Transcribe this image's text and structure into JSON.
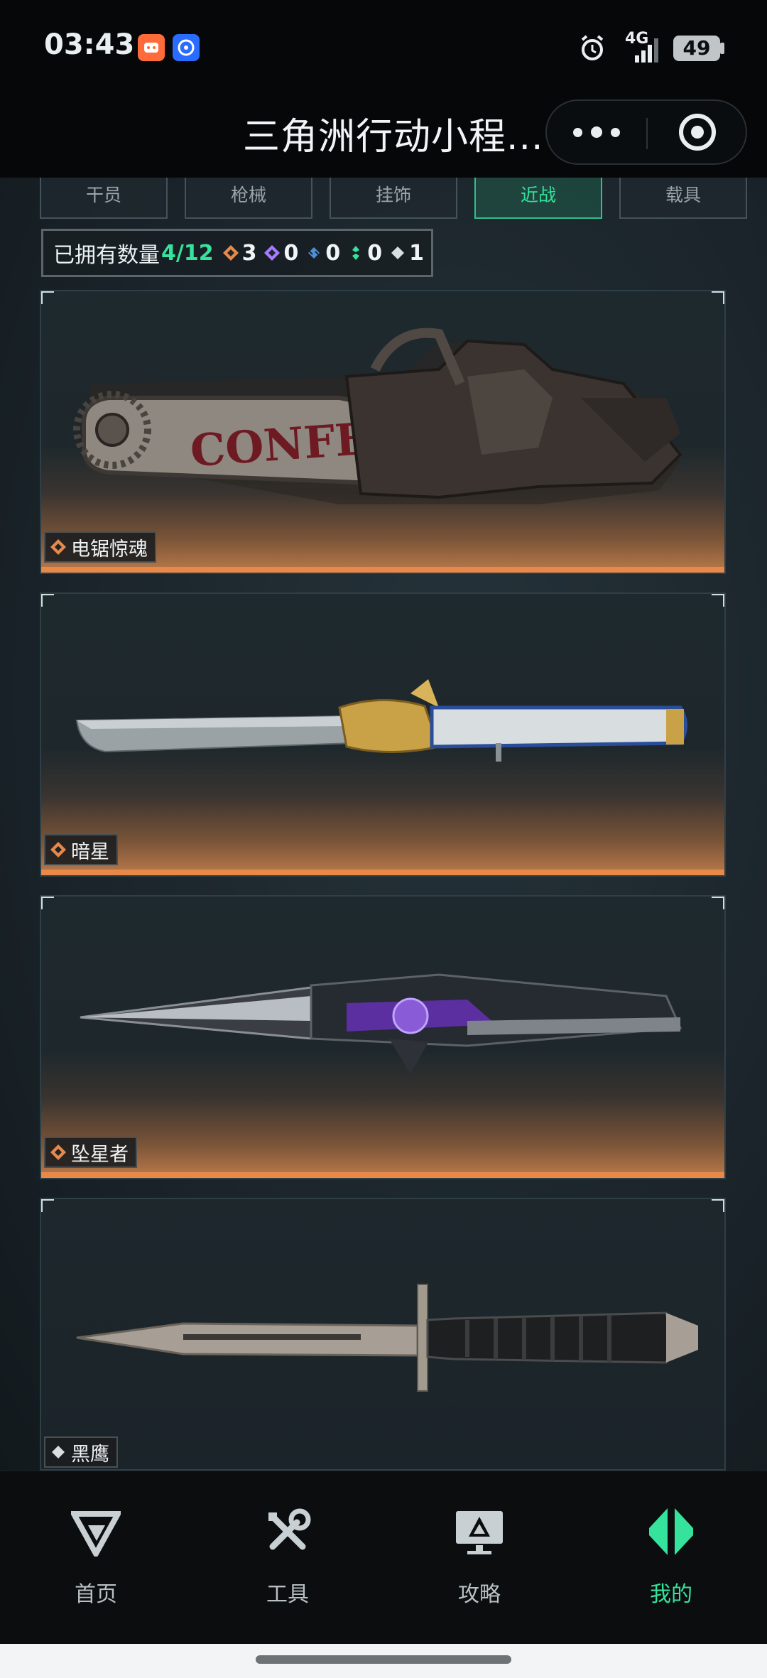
{
  "status_bar": {
    "time": "03:43",
    "network": "4G",
    "battery": "49"
  },
  "header": {
    "title": "三角洲行动小程..."
  },
  "tabs": [
    {
      "label": "干员",
      "active": false
    },
    {
      "label": "枪械",
      "active": false
    },
    {
      "label": "挂饰",
      "active": false
    },
    {
      "label": "近战",
      "active": true
    },
    {
      "label": "载具",
      "active": false
    }
  ],
  "owned": {
    "label": "已拥有数量",
    "count": "4/12",
    "rarities": [
      {
        "icon": "orange-diamond-icon",
        "color": "#e8894a",
        "count": "3"
      },
      {
        "icon": "purple-diamond-icon",
        "color": "#a77bff",
        "count": "0"
      },
      {
        "icon": "blue-diamond-icon",
        "color": "#4f8fd6",
        "count": "0"
      },
      {
        "icon": "green-diamond-icon",
        "color": "#35e39c",
        "count": "0"
      },
      {
        "icon": "white-diamond-icon",
        "color": "#d9dee1",
        "count": "1"
      }
    ]
  },
  "items": [
    {
      "name": "电锯惊魂",
      "rarity": "orange",
      "weapon": "chainsaw"
    },
    {
      "name": "暗星",
      "rarity": "orange",
      "weapon": "blade"
    },
    {
      "name": "坠星者",
      "rarity": "orange",
      "weapon": "dagger"
    },
    {
      "name": "黑鹰",
      "rarity": "white",
      "weapon": "combat-knife"
    }
  ],
  "bottom_nav": [
    {
      "label": "首页",
      "icon": "delta-logo-icon",
      "active": false
    },
    {
      "label": "工具",
      "icon": "tools-icon",
      "active": false
    },
    {
      "label": "攻略",
      "icon": "guide-icon",
      "active": false
    },
    {
      "label": "我的",
      "icon": "profile-logo-icon",
      "active": true
    }
  ],
  "colors": {
    "accent": "#35e39c",
    "legendary": "#e8894a"
  }
}
